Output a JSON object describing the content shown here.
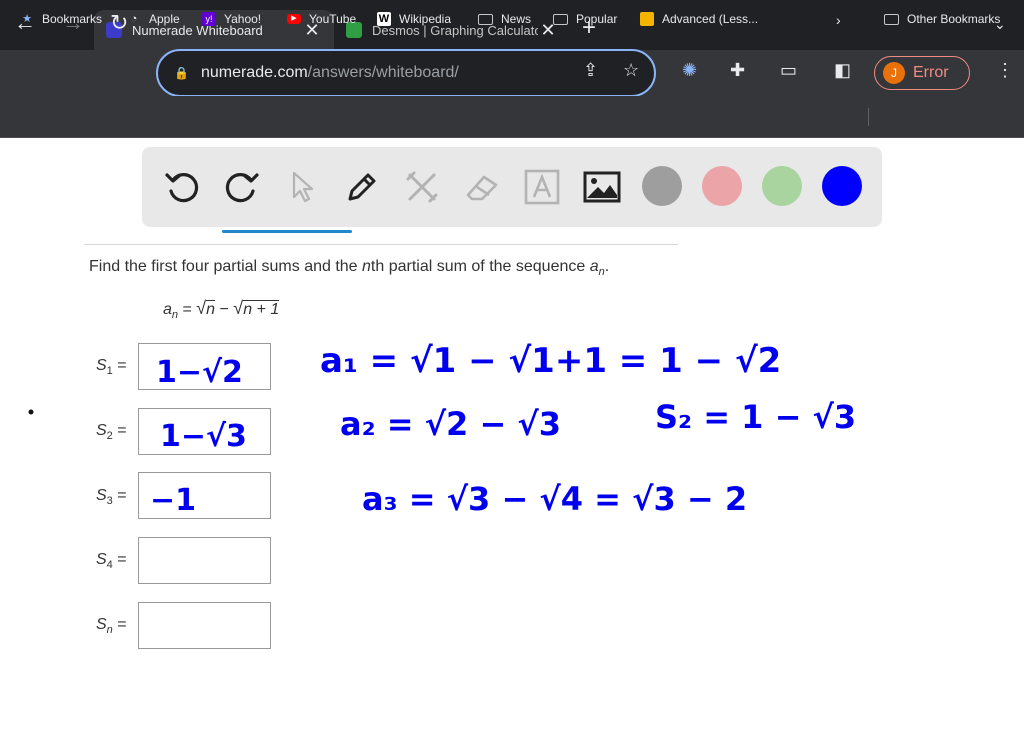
{
  "browser": {
    "tabs": [
      {
        "title": "Numerade Whiteboard",
        "active": true,
        "favicon_color": "#3c3cc8"
      },
      {
        "title": "Desmos | Graphing Calculato",
        "active": false,
        "favicon_color": "#2f9e44"
      }
    ],
    "url": {
      "domain": "numerade.com",
      "path": "/answers/whiteboard/"
    },
    "profile_initial": "J",
    "profile_status": "Error",
    "accent": "#8ab4f8"
  },
  "bookmarks": {
    "items": [
      {
        "label": "Bookmarks",
        "icon": "star-icon"
      },
      {
        "label": "Apple",
        "icon": "apple-icon"
      },
      {
        "label": "Yahoo!",
        "icon": "yahoo-icon"
      },
      {
        "label": "YouTube",
        "icon": "youtube-icon"
      },
      {
        "label": "Wikipedia",
        "icon": "wikipedia-icon"
      },
      {
        "label": "News",
        "icon": "folder-icon"
      },
      {
        "label": "Popular",
        "icon": "folder-icon"
      },
      {
        "label": "Advanced (Less...",
        "icon": "advanced-icon"
      }
    ],
    "other": "Other Bookmarks"
  },
  "whiteboard": {
    "tools": [
      "undo-icon",
      "redo-icon",
      "pointer-icon",
      "pen-icon",
      "tools-icon",
      "eraser-icon",
      "text-icon",
      "image-icon"
    ],
    "colors": [
      "#9e9e9e",
      "#eba5a8",
      "#a9d4a0",
      "#0000ff"
    ],
    "selected_color": "#0000ff"
  },
  "problem": {
    "question_pre": "Find the first four partial sums and the ",
    "question_n": "n",
    "question_post": "th partial sum of the sequence ",
    "question_a": "a",
    "question_sub": "n",
    "question_end": ".",
    "formula_lhs": "a",
    "formula_lhs_sub": "n",
    "formula_eq": " = ",
    "formula_r1": "n",
    "formula_minus": " − ",
    "formula_r2": "n + 1",
    "sums": [
      {
        "label": "S",
        "sub": "1",
        "eq": "="
      },
      {
        "label": "S",
        "sub": "2",
        "eq": "="
      },
      {
        "label": "S",
        "sub": "3",
        "eq": "="
      },
      {
        "label": "S",
        "sub": "4",
        "eq": "="
      },
      {
        "label": "S",
        "sub": "n",
        "eq": "="
      }
    ]
  },
  "handwriting": {
    "ink_color": "#0000ee",
    "box_s1": "1−√2",
    "box_s2": "1−√3",
    "box_s3": "−1",
    "line1": "a₁ = √1 − √1+1 = 1 − √2",
    "line2": "a₂ = √2 − √3",
    "line2b": "S₂ = 1 − √3",
    "line3": "a₃ = √3 − √4 = √3 − 2"
  }
}
